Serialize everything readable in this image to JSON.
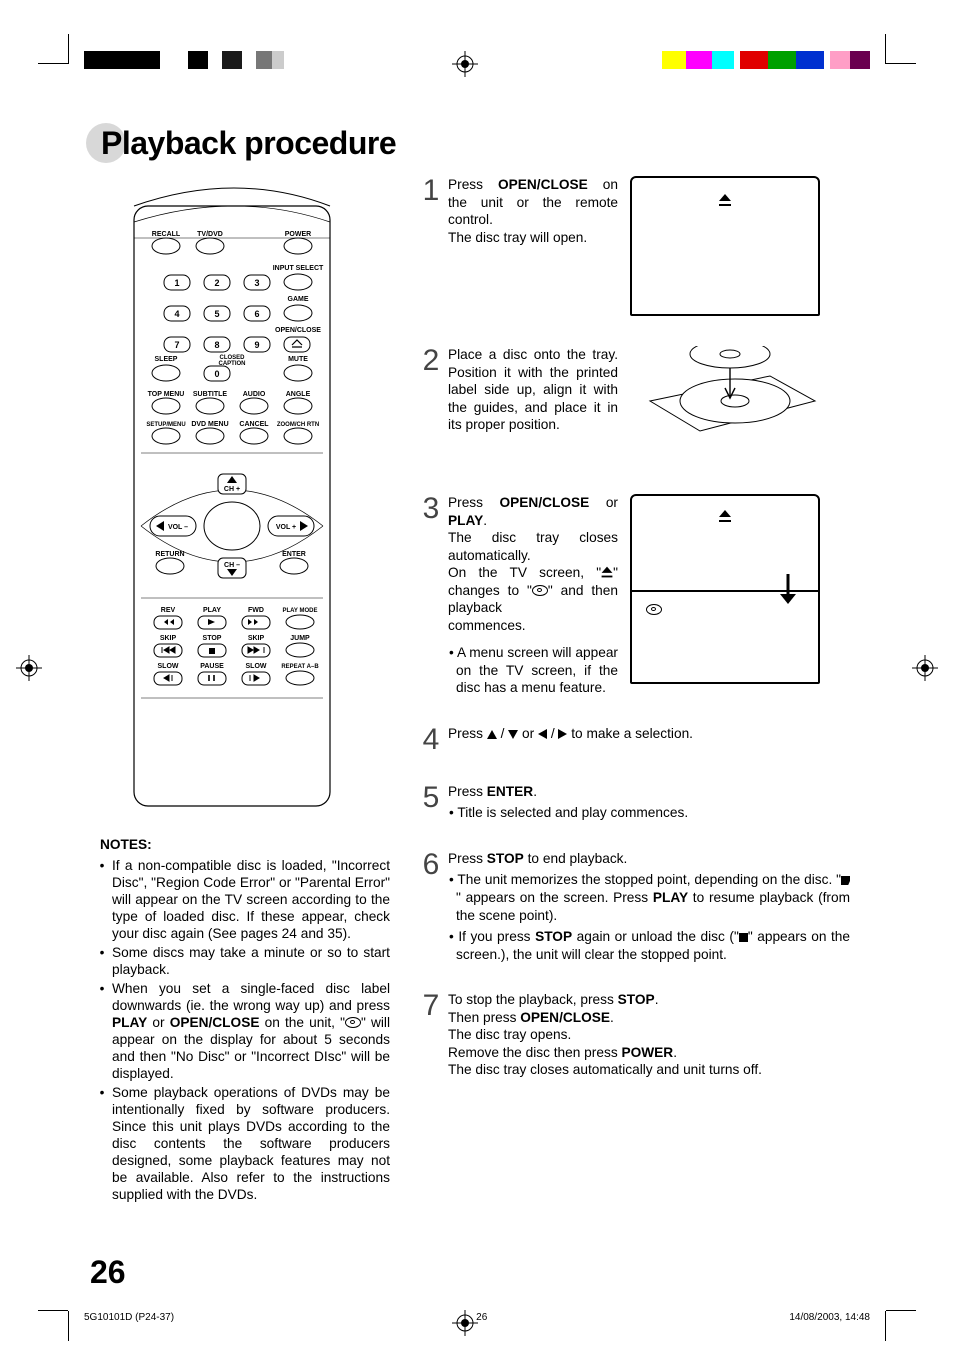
{
  "title": "Playback procedure",
  "page_number": "26",
  "footer": {
    "left": "5G10101D (P24-37)",
    "center": "26",
    "right": "14/08/2003, 14:48"
  },
  "remote": {
    "row1": {
      "a": "RECALL",
      "b": "TV/DVD",
      "c": "POWER"
    },
    "input_select": "INPUT SELECT",
    "game": "GAME",
    "open_close": "OPEN/CLOSE",
    "digits": [
      "1",
      "2",
      "3",
      "4",
      "5",
      "6",
      "7",
      "8",
      "9",
      "0"
    ],
    "sleep": "SLEEP",
    "closed_caption_l1": "CLOSED",
    "closed_caption_l2": "CAPTION",
    "mute": "MUTE",
    "row_menu": {
      "a": "TOP MENU",
      "b": "SUBTITLE",
      "c": "AUDIO",
      "d": "ANGLE"
    },
    "row_setup": {
      "a": "SETUP/MENU",
      "b": "DVD MENU",
      "c": "CANCEL",
      "d": "ZOOM/CH RTN"
    },
    "nav": {
      "up": "CH +",
      "down": "CH –",
      "left": "VOL –",
      "right": "VOL +",
      "ret": "RETURN",
      "enter": "ENTER"
    },
    "transport": {
      "r1": {
        "a": "REV",
        "b": "PLAY",
        "c": "FWD",
        "d": "PLAY MODE"
      },
      "r2": {
        "a": "SKIP",
        "b": "STOP",
        "c": "SKIP",
        "d": "JUMP"
      },
      "r3": {
        "a": "SLOW",
        "b": "PAUSE",
        "c": "SLOW",
        "d": "REPEAT A–B"
      }
    }
  },
  "notes": {
    "heading": "NOTES:",
    "items": [
      "If a non-compatible disc is loaded, \"Incorrect Disc\", \"Region Code Error\" or \"Parental Error\" will appear on the TV screen according to the type of loaded disc. If these appear, check your disc again (See pages 24 and 35).",
      "Some discs may take a minute or so to start playback.",
      "When you set a single-faced disc label downwards (ie. the wrong way up) and press PLAY or OPEN/CLOSE on the unit, \" \" will appear on the display for about 5 seconds and then \"No Disc\" or \"Incorrect DIsc\" will be displayed.",
      "Some playback operations of DVDs may be intentionally fixed by software producers. Since this unit plays DVDs according to the disc contents the software producers designed, some playback features may not be available. Also refer to the instructions supplied with the DVDs."
    ],
    "note3_pre": "When you set a single-faced disc label downwards (ie. the wrong way up) and press ",
    "note3_play": "PLAY",
    "note3_mid_or": " or ",
    "note3_oc": "OPEN/CLOSE",
    "note3_mid2": " on the unit, \"",
    "note3_post": "\" will appear on the display for about 5 seconds and then \"No Disc\" or \"Incorrect DIsc\" will be displayed."
  },
  "steps": {
    "s1_a": "Press ",
    "s1_oc": "OPEN/CLOSE",
    "s1_b": " on the unit or the remote control.",
    "s1_c": "The disc tray will open.",
    "s2_a": "Place a disc onto the tray. Position it with the printed label side up, align it with the guides, and place it in its proper position.",
    "s3_a": "Press ",
    "s3_oc": "OPEN/CLOSE",
    "s3_or": " or ",
    "s3_play": "PLAY",
    "s3_dot": ".",
    "s3_b": "The disc tray closes automatically.",
    "s3_c_pre": "On the TV screen, \"",
    "s3_c_mid": "\" changes to \"",
    "s3_c_post": "\" and then playback",
    "s3_c_last": "commences.",
    "s3_sub": "A menu screen will appear on the TV screen, if the disc has a menu feature.",
    "s4_a": "Press ",
    "s4_or_sep": " or ",
    "s4_b": " to make a selection.",
    "s5_a": "Press ",
    "s5_enter": "ENTER",
    "s5_dot": ".",
    "s5_sub": "Title is selected and play commences.",
    "s6_a": "Press ",
    "s6_stop": "STOP",
    "s6_b": " to end playback.",
    "s6_sub1_pre": "The unit memorizes the stopped point, depending on the disc. \"",
    "s6_sub1_mid": "\" appears on the screen. Press ",
    "s6_sub1_play": "PLAY",
    "s6_sub1_post": " to resume playback (from the scene point).",
    "s6_sub2_pre": "If you press ",
    "s6_sub2_stop": "STOP",
    "s6_sub2_mid": " again or unload the disc (\"",
    "s6_sub2_post": "\" appears on the screen.), the unit will clear the stopped point.",
    "s7_a": "To stop the playback, press ",
    "s7_stop": "STOP",
    "s7_dot": ".",
    "s7_b": "Then press ",
    "s7_oc": "OPEN/CLOSE",
    "s7_dot2": ".",
    "s7_c": "The disc tray opens.",
    "s7_d": "Remove the disc then press ",
    "s7_power": "POWER",
    "s7_dot3": ".",
    "s7_e": "The disc tray closes automatically and unit turns off."
  }
}
